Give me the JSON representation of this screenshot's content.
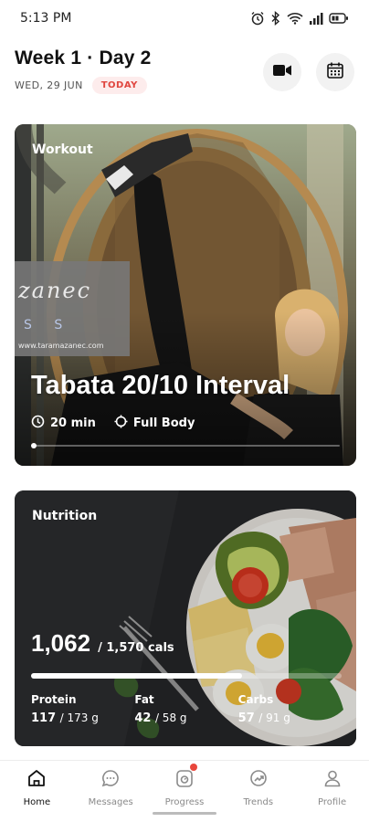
{
  "status_bar": {
    "time": "5:13 PM"
  },
  "header": {
    "title": "Week 1 · Day 2",
    "date": "WED, 29 JUN",
    "today_badge": "TODAY"
  },
  "workout": {
    "label": "Workout",
    "title": "Tabata 20/10 Interval",
    "duration": "20 min",
    "focus": "Full Body",
    "logo_text": "zanec",
    "logo_sub": "S S",
    "logo_url": "www.taramazanec.com"
  },
  "nutrition": {
    "label": "Nutrition",
    "calories_value": "1,062",
    "calories_target": "/ 1,570 cals",
    "progress": 0.68,
    "macros": [
      {
        "label": "Protein",
        "value": "117",
        "target": "/ 173 g"
      },
      {
        "label": "Fat",
        "value": "42",
        "target": "/ 58 g"
      },
      {
        "label": "Carbs",
        "value": "57",
        "target": "/ 91 g"
      }
    ]
  },
  "tabs": [
    {
      "label": "Home",
      "icon": "home-icon",
      "active": true
    },
    {
      "label": "Messages",
      "icon": "message-icon",
      "active": false
    },
    {
      "label": "Progress",
      "icon": "progress-icon",
      "active": false
    },
    {
      "label": "Trends",
      "icon": "trends-icon",
      "active": false
    },
    {
      "label": "Profile",
      "icon": "profile-icon",
      "active": false
    }
  ],
  "colors": {
    "accent_red": "#e0463f",
    "badge_bg": "#fdecec",
    "nutrition_bg": "#2e2f31"
  }
}
